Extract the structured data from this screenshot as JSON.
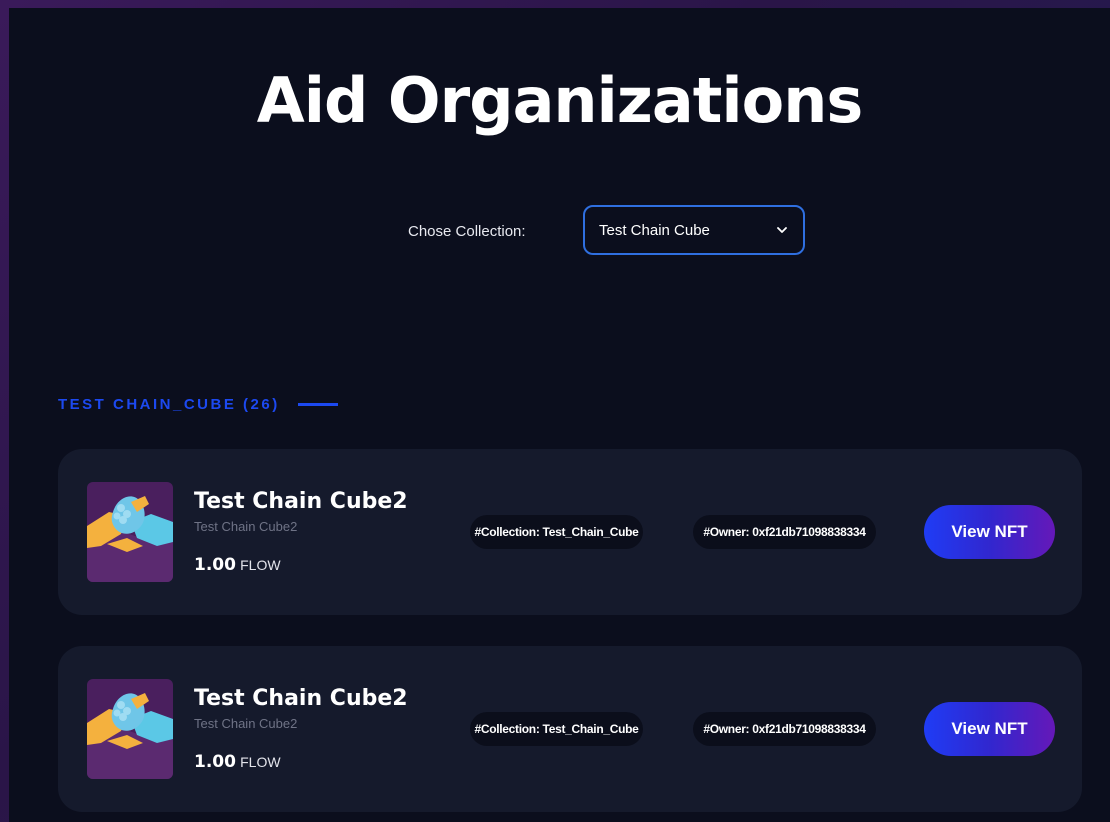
{
  "header": {
    "title": "Aid Organizations"
  },
  "collection_picker": {
    "label": "Chose Collection:",
    "selected": "Test Chain Cube",
    "border_color": "#2f6fe0"
  },
  "section": {
    "heading": "TEST CHAIN_CUBE (26)",
    "accent_color": "#1c49f0"
  },
  "cards": [
    {
      "name": "Test Chain Cube2",
      "subtitle": "Test Chain Cube2",
      "price_amount": "1.00",
      "price_unit": "FLOW",
      "collection_tag": "#Collection: Test_Chain_Cube",
      "owner_tag": "#Owner: 0xf21db71098838334",
      "button_label": "View NFT",
      "image_icon": "handshake-icon"
    },
    {
      "name": "Test Chain Cube2",
      "subtitle": "Test Chain Cube2",
      "price_amount": "1.00",
      "price_unit": "FLOW",
      "collection_tag": "#Collection: Test_Chain_Cube",
      "owner_tag": "#Owner: 0xf21db71098838334",
      "button_label": "View NFT",
      "image_icon": "handshake-icon"
    }
  ],
  "colors": {
    "background": "#0b0e1d",
    "card": "#151a2c",
    "button_gradient_start": "#1f3cf5",
    "button_gradient_end": "#6518b8"
  }
}
